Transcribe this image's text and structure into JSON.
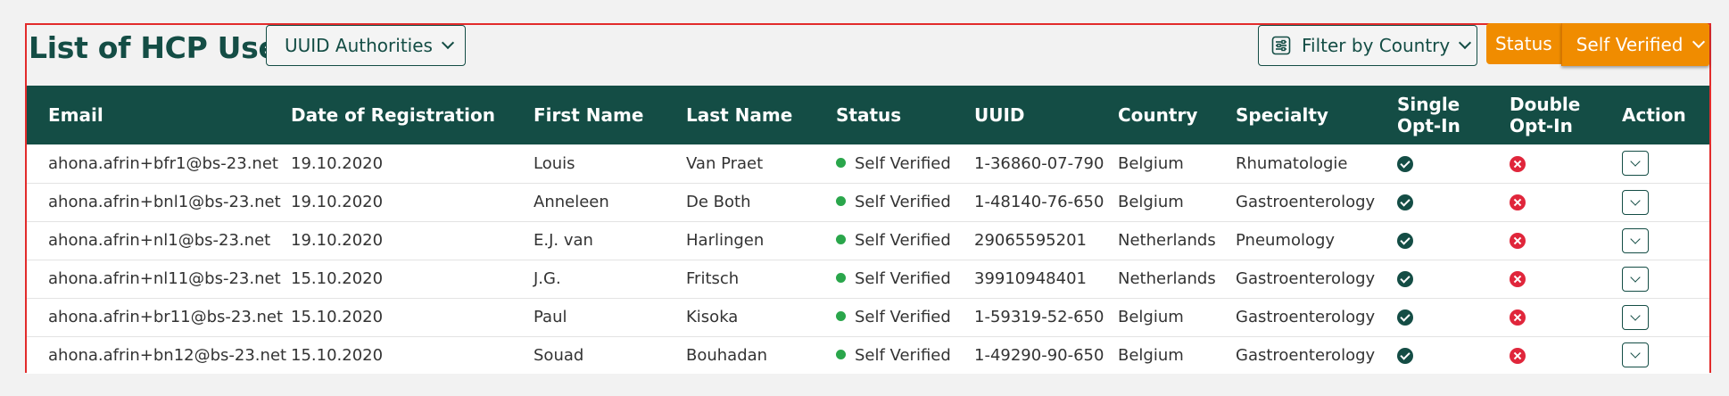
{
  "header": {
    "title": "List of HCP User",
    "uuid_button_label": "UUID Authorities",
    "filter_button_label": "Filter by Country",
    "status_label": "Status",
    "status_value": "Self Verified"
  },
  "colors": {
    "primary": "#144d45",
    "accent": "#f08c00",
    "status_dot": "#2aa64b",
    "negative": "#e0263b"
  },
  "table": {
    "columns": {
      "email": "Email",
      "date": "Date of Registration",
      "first_name": "First Name",
      "last_name": "Last Name",
      "status": "Status",
      "uuid": "UUID",
      "country": "Country",
      "specialty": "Specialty",
      "single_opt_in_1": "Single",
      "single_opt_in_2": "Opt-In",
      "double_opt_in_1": "Double",
      "double_opt_in_2": "Opt-In",
      "action": "Action"
    },
    "rows": [
      {
        "email": "ahona.afrin+bfr1@bs-23.net",
        "date": "19.10.2020",
        "first_name": "Louis",
        "last_name": "Van Praet",
        "status": "Self Verified",
        "uuid": "1-36860-07-790",
        "country": "Belgium",
        "specialty": "Rhumatologie",
        "single_opt_in": "check-icon",
        "double_opt_in": "x-icon"
      },
      {
        "email": "ahona.afrin+bnl1@bs-23.net",
        "date": "19.10.2020",
        "first_name": "Anneleen",
        "last_name": "De Both",
        "status": "Self Verified",
        "uuid": "1-48140-76-650",
        "country": "Belgium",
        "specialty": "Gastroenterology",
        "single_opt_in": "check-icon",
        "double_opt_in": "x-icon"
      },
      {
        "email": "ahona.afrin+nl1@bs-23.net",
        "date": "19.10.2020",
        "first_name": "E.J. van",
        "last_name": "Harlingen",
        "status": "Self Verified",
        "uuid": "29065595201",
        "country": "Netherlands",
        "specialty": "Pneumology",
        "single_opt_in": "check-icon",
        "double_opt_in": "x-icon"
      },
      {
        "email": "ahona.afrin+nl11@bs-23.net",
        "date": "15.10.2020",
        "first_name": "J.G.",
        "last_name": "Fritsch",
        "status": "Self Verified",
        "uuid": "39910948401",
        "country": "Netherlands",
        "specialty": "Gastroenterology",
        "single_opt_in": "check-icon",
        "double_opt_in": "x-icon"
      },
      {
        "email": "ahona.afrin+br11@bs-23.net",
        "date": "15.10.2020",
        "first_name": "Paul",
        "last_name": "Kisoka",
        "status": "Self Verified",
        "uuid": "1-59319-52-650",
        "country": "Belgium",
        "specialty": "Gastroenterology",
        "single_opt_in": "check-icon",
        "double_opt_in": "x-icon"
      },
      {
        "email": "ahona.afrin+bn12@bs-23.net",
        "date": "15.10.2020",
        "first_name": "Souad",
        "last_name": "Bouhadan",
        "status": "Self Verified",
        "uuid": "1-49290-90-650",
        "country": "Belgium",
        "specialty": "Gastroenterology",
        "single_opt_in": "check-icon",
        "double_opt_in": "x-icon"
      }
    ]
  }
}
